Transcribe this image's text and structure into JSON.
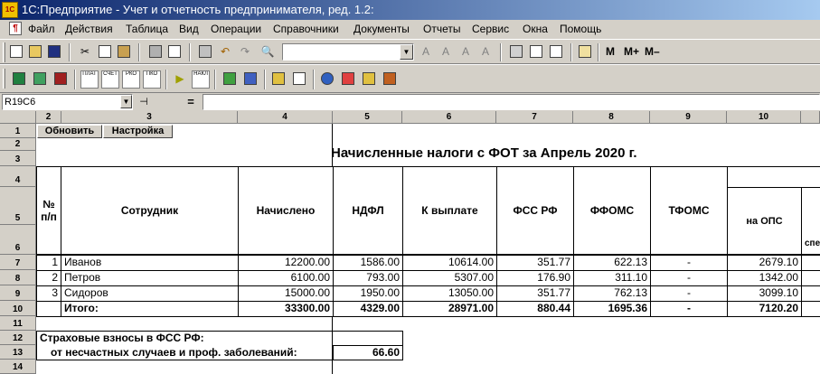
{
  "window": {
    "title": "1С:Предприятие - Учет и отчетность предпринимателя, ред. 1.2:",
    "app_icon": "1С"
  },
  "menu": [
    "Файл",
    "Действия",
    "Таблица",
    "Вид",
    "Операции",
    "Справочники",
    "Документы",
    "Отчеты",
    "Сервис",
    "Окна",
    "Помощь"
  ],
  "toolbar": {
    "m_label": "M",
    "m_plus_label": "M+",
    "m_minus_label": "M–",
    "doc_buttons": [
      "ПЛАТ",
      "СЧЕТ",
      "РКО",
      "ПКО",
      "НАКЛ"
    ]
  },
  "address": {
    "cell_ref": "R19C6",
    "eq": "="
  },
  "sheet": {
    "columns": [
      "2",
      "3",
      "4",
      "5",
      "6",
      "7",
      "8",
      "9",
      "10"
    ],
    "rows": [
      "1",
      "2",
      "3",
      "4",
      "5",
      "6",
      "7",
      "8",
      "9",
      "10",
      "11",
      "12",
      "13",
      "14"
    ],
    "buttons": {
      "refresh": "Обновить",
      "settings": "Настройка"
    },
    "report_title": "Начисленные налоги с ФОТ за Апрель 2020 г.",
    "headers": {
      "num": "№\nп/п",
      "employee": "Сотрудник",
      "accrued": "Начислено",
      "ndfl": "НДФЛ",
      "to_pay": "К выплате",
      "fss": "ФСС РФ",
      "ffoms": "ФФОМС",
      "tfoms": "ТФОМС",
      "ops": "на ОПС",
      "cut": "спе"
    },
    "rows_data": [
      {
        "num": "1",
        "name": "Иванов",
        "accrued": "12200.00",
        "ndfl": "1586.00",
        "to_pay": "10614.00",
        "fss": "351.77",
        "ffoms": "622.13",
        "tfoms": "-",
        "ops": "2679.10"
      },
      {
        "num": "2",
        "name": "Петров",
        "accrued": "6100.00",
        "ndfl": "793.00",
        "to_pay": "5307.00",
        "fss": "176.90",
        "ffoms": "311.10",
        "tfoms": "-",
        "ops": "1342.00"
      },
      {
        "num": "3",
        "name": "Сидоров",
        "accrued": "15000.00",
        "ndfl": "1950.00",
        "to_pay": "13050.00",
        "fss": "351.77",
        "ffoms": "762.13",
        "tfoms": "-",
        "ops": "3099.10"
      }
    ],
    "total": {
      "label": "Итого:",
      "accrued": "33300.00",
      "ndfl": "4329.00",
      "to_pay": "28971.00",
      "fss": "880.44",
      "ffoms": "1695.36",
      "tfoms": "-",
      "ops": "7120.20"
    },
    "fss_section": {
      "title": "Страховые взносы в ФСС РФ:",
      "line": "от несчастных случаев и проф. заболеваний:",
      "value": "66.60"
    }
  }
}
